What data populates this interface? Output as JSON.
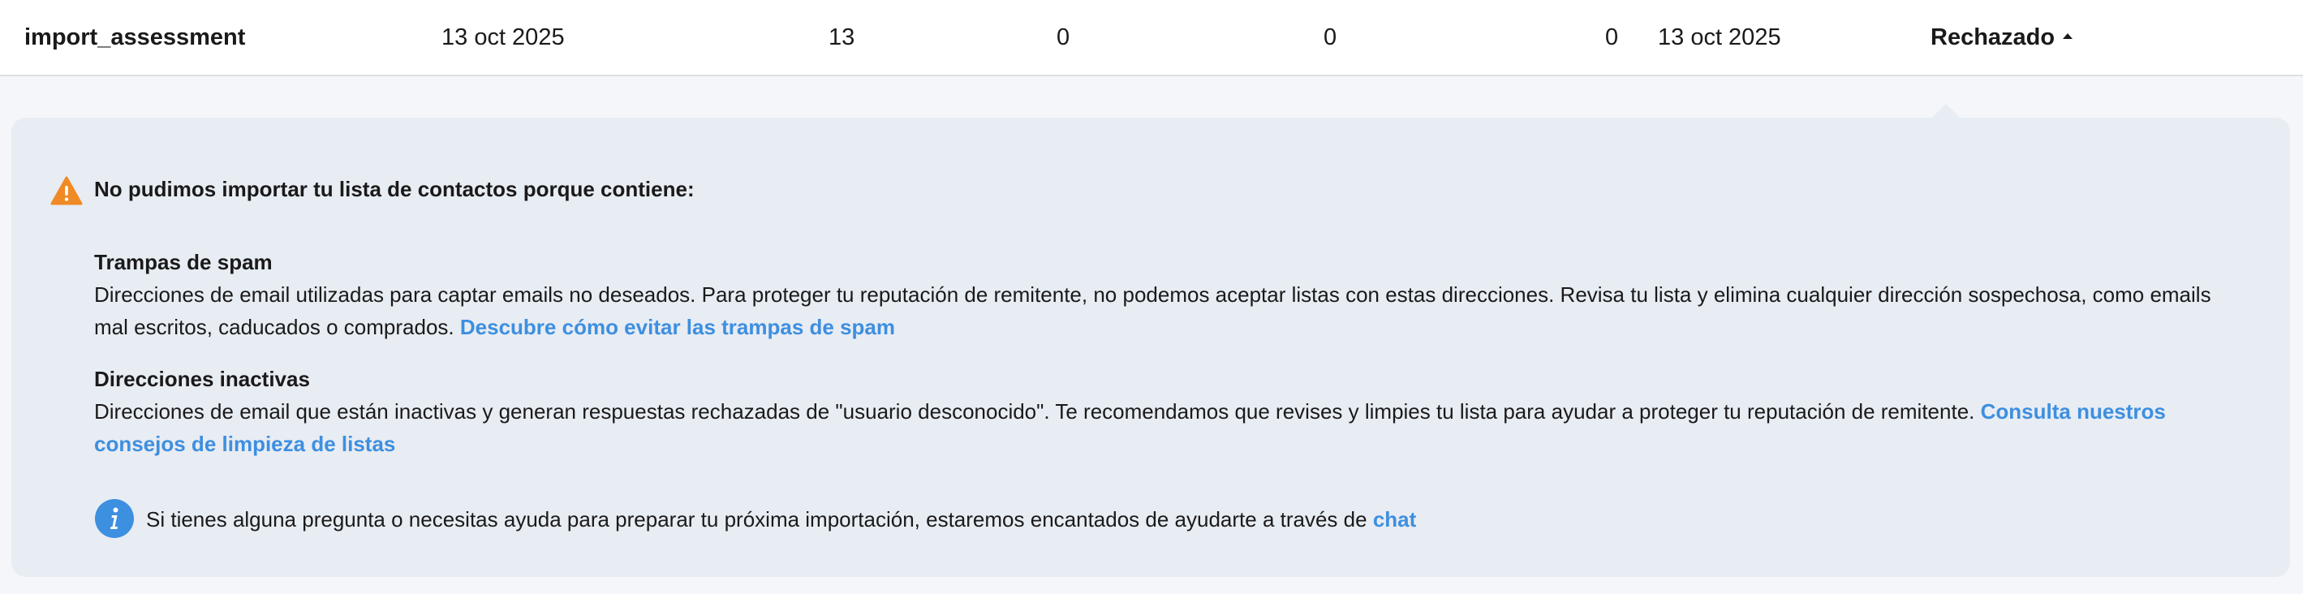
{
  "row": {
    "name": "import_assessment",
    "date_created": "13 oct 2025",
    "count_1": "13",
    "count_2": "0",
    "count_3": "0",
    "count_4": "0",
    "date_updated": "13 oct 2025",
    "status": "Rechazado"
  },
  "alert": {
    "icon": "warning-icon",
    "title": "No pudimos importar tu lista de contactos porque contiene:",
    "sections": [
      {
        "title": "Trampas de spam",
        "body": "Direcciones de email utilizadas para captar emails no deseados. Para proteger tu reputación de remitente, no podemos aceptar listas con estas direcciones. Revisa tu lista y elimina cualquier dirección sospechosa, como emails mal escritos, caducados o comprados.",
        "link": "Descubre cómo evitar las trampas de spam"
      },
      {
        "title": "Direcciones inactivas",
        "body": "Direcciones de email que están inactivas y generan respuestas rechazadas de \"usuario desconocido\". Te recomendamos que revises y limpies tu lista para ayudar a proteger tu reputación de remitente.",
        "link": "Consulta nuestros consejos de limpieza de listas"
      }
    ],
    "help": {
      "icon": "info-icon",
      "text": "Si tienes alguna pregunta o necesitas ayuda para preparar tu próxima importación, estaremos encantados de ayudarte a través de",
      "link": "chat"
    }
  },
  "colors": {
    "link": "#3d8fe0",
    "warning": "#f08a24",
    "info": "#3d8fe0",
    "panel_bg": "#e8ecf3"
  }
}
